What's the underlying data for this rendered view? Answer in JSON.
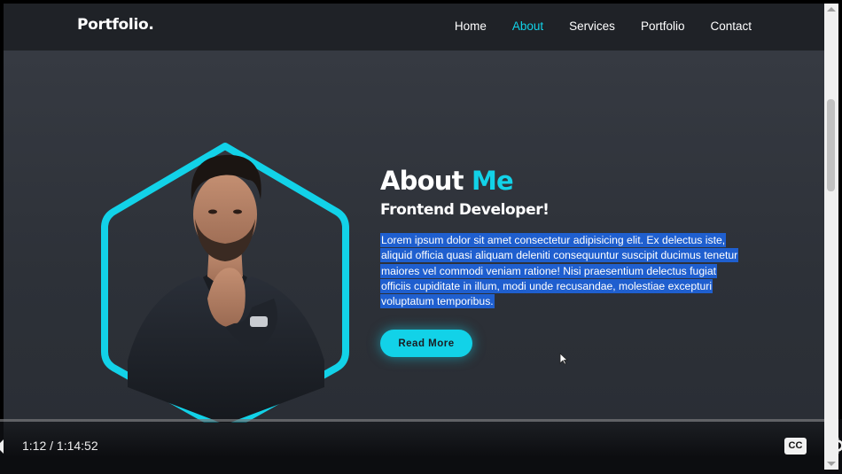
{
  "nav": {
    "logo": "Portfolio.",
    "links": [
      {
        "label": "Home",
        "active": false
      },
      {
        "label": "About",
        "active": true
      },
      {
        "label": "Services",
        "active": false
      },
      {
        "label": "Portfolio",
        "active": false
      },
      {
        "label": "Contact",
        "active": false
      }
    ]
  },
  "about": {
    "title_main": "About ",
    "title_accent": "Me",
    "subtitle": "Frontend Developer!",
    "paragraph": "Lorem ipsum dolor sit amet consectetur adipisicing elit. Ex delectus iste, aliquid officia quasi aliquam deleniti consequuntur suscipit ducimus tenetur maiores vel commodi veniam ratione! Nisi praesentium delectus fugiat officiis cupiditate in illum, modi unde recusandae, molestiae excepturi voluptatum temporibus.",
    "button_label": "Read More"
  },
  "player": {
    "time": "1:12 / 1:14:52",
    "cc_label": "CC"
  },
  "colors": {
    "accent": "#12d2e8",
    "background": "#2b2f35",
    "nav_background": "#1f2227",
    "selection": "#1f5fcf"
  },
  "icons": {
    "cursor": "mouse-pointer-icon",
    "cc": "closed-captions-icon",
    "settings": "gear-icon"
  }
}
